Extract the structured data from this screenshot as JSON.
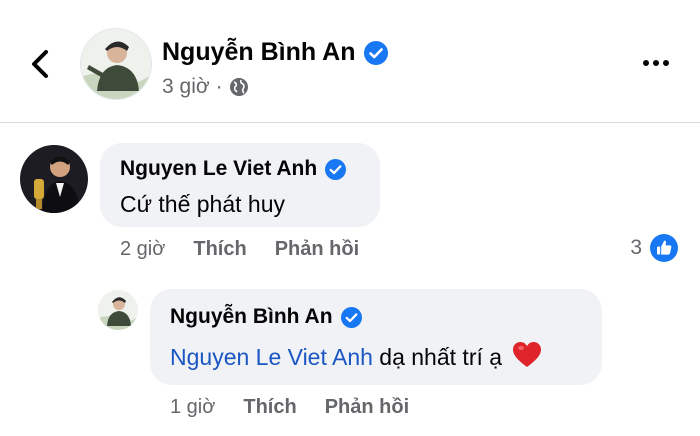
{
  "post": {
    "author": "Nguyễn Bình An",
    "time": "3 giờ",
    "separator": "·",
    "privacy_icon": "globe-icon"
  },
  "comments": [
    {
      "author": "Nguyen Le Viet Anh",
      "text": "Cứ thế phát huy",
      "time": "2 giờ",
      "like_label": "Thích",
      "reply_label": "Phản hồi",
      "reaction_count": "3",
      "reaction_icon": "like-icon"
    }
  ],
  "reply": {
    "author": "Nguyễn Bình An",
    "mention": "Nguyen Le Viet Anh",
    "text": " dạ nhất trí ạ",
    "emoji_icon": "heart-icon",
    "time": "1 giờ",
    "like_label": "Thích",
    "reply_label": "Phản hồi"
  },
  "colors": {
    "verified": "#1877f2",
    "mention": "#1a56c4",
    "bubble": "#f0f2f5",
    "secondary_text": "#65676b",
    "heart": "#e0242b"
  }
}
